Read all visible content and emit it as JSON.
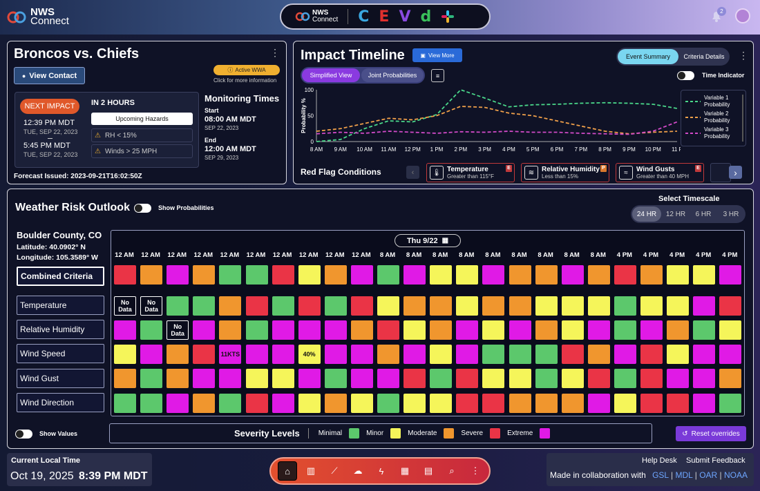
{
  "header": {
    "logo_line1": "NWS",
    "logo_line2": "Connect",
    "app_logo_line1": "NWS",
    "app_logo_line2": "Connect",
    "notification_count": "2"
  },
  "event": {
    "title": "Broncos vs. Chiefs",
    "view_contact": "View Contact",
    "active_wwa": "Active WWA",
    "active_wwa_hint": "Click for more information",
    "next_impact": "NEXT IMPACT",
    "in_time": "IN 2 HOURS",
    "start_time": "12:39 PM MDT",
    "start_date": "TUE, SEP 22, 2023",
    "end_time": "5:45 PM MDT",
    "end_date": "TUE, SEP 22, 2023",
    "upcoming_hazards": "Upcoming Hazards",
    "hazard1": "RH < 15%",
    "hazard2": "Winds > 25 MPH",
    "monitoring_title": "Monitoring Times",
    "start_label": "Start",
    "mon_start_time": "08:00 AM MDT",
    "mon_start_date": "SEP 22, 2023",
    "end_label": "End",
    "mon_end_time": "12:00 AM MDT",
    "mon_end_date": "SEP 29, 2023",
    "forecast_issued": "Forecast Issued: 2023-09-21T16:02:50Z"
  },
  "impact": {
    "title": "Impact Timeline",
    "view_more": "View More",
    "event_summary": "Event Summary",
    "criteria_details": "Criteria Details",
    "simplified_view": "Simplified View",
    "joint_probabilities": "Joint Probabilities",
    "time_indicator": "Time Indicator",
    "red_flag_title": "Red Flag Conditions",
    "red_flags": [
      {
        "label": "Temperature",
        "sub": "Greater than 115°F",
        "flag": "E",
        "flag_color": "#c0393b"
      },
      {
        "label": "Relative Humidity",
        "sub": "Less than 15%",
        "flag": "P",
        "flag_color": "#d9782d"
      },
      {
        "label": "Wind Gusts",
        "sub": "Greater than 40 MPH",
        "flag": "E",
        "flag_color": "#c0393b"
      }
    ]
  },
  "chart_data": {
    "type": "line",
    "ylabel": "Probability %",
    "ylim": [
      0,
      100
    ],
    "yticks": [
      "100",
      "50",
      "0"
    ],
    "categories": [
      "8 AM",
      "9 AM",
      "10 AM",
      "11 AM",
      "12 PM",
      "1 PM",
      "2 PM",
      "3 PM",
      "4 PM",
      "5 PM",
      "6 PM",
      "7 PM",
      "8 PM",
      "9 PM",
      "10 PM",
      "11 P"
    ],
    "series": [
      {
        "name": "Variable 1 Probability",
        "color": "#4ad88a",
        "values": [
          0,
          4,
          25,
          40,
          38,
          52,
          100,
          84,
          67,
          71,
          72,
          74,
          75,
          74,
          72,
          64
        ]
      },
      {
        "name": "Variable 2 Probability",
        "color": "#f0a04a",
        "values": [
          20,
          25,
          35,
          45,
          42,
          50,
          68,
          66,
          55,
          50,
          40,
          30,
          20,
          15,
          18,
          20
        ]
      },
      {
        "name": "Variable 3 Probability",
        "color": "#d24ac8",
        "values": [
          15,
          18,
          16,
          20,
          18,
          16,
          19,
          18,
          20,
          18,
          18,
          16,
          15,
          14,
          20,
          38
        ]
      }
    ]
  },
  "outlook": {
    "title": "Weather Risk Outlook",
    "show_probabilities": "Show Probabilities",
    "select_timescale": "Select Timescale",
    "timescales": [
      "24 HR",
      "12 HR",
      "6 HR",
      "3 HR"
    ],
    "location": "Boulder County, CO",
    "latitude": "Latitude: 40.0902° N",
    "longitude": "Longitude: 105.3589° W",
    "date": "Thu 9/22",
    "time_ticks": [
      "12 AM",
      "12 AM",
      "12 AM",
      "12 AM",
      "12 AM",
      "12 AM",
      "12 AM",
      "12 AM",
      "12 AM",
      "12 AM",
      "8 AM",
      "8 AM",
      "8 AM",
      "8 AM",
      "8 AM",
      "8 AM",
      "8 AM",
      "8 AM",
      "8 AM",
      "4 PM",
      "4 PM",
      "4 PM",
      "4 PM",
      "4 PM"
    ],
    "rows": [
      {
        "label": "Combined Criteria",
        "cells": [
          "R",
          "O",
          "M",
          "O",
          "G",
          "G",
          "R",
          "Y",
          "O",
          "M",
          "G",
          "M",
          "Y",
          "Y",
          "M",
          "O",
          "O",
          "M",
          "O",
          "R",
          "O",
          "Y",
          "Y",
          "M"
        ]
      },
      {
        "label": "Temperature",
        "cells": [
          "N",
          "N",
          "G",
          "G",
          "O",
          "R",
          "G",
          "R",
          "G",
          "R",
          "Y",
          "O",
          "O",
          "Y",
          "O",
          "O",
          "Y",
          "Y",
          "Y",
          "G",
          "Y",
          "Y",
          "M",
          "R"
        ]
      },
      {
        "label": "Relative Humidity",
        "cells": [
          "M",
          "G",
          "N",
          "M",
          "O",
          "G",
          "M",
          "M",
          "M",
          "O",
          "R",
          "Y",
          "O",
          "M",
          "Y",
          "M",
          "O",
          "Y",
          "M",
          "G",
          "M",
          "O",
          "G",
          "Y"
        ]
      },
      {
        "label": "Wind Speed",
        "cells": [
          "Y",
          "M",
          "O",
          "R",
          "M:11KTS",
          "M",
          "M",
          "Y:40%",
          "M",
          "M",
          "O",
          "M",
          "Y",
          "M",
          "G",
          "G",
          "G",
          "R",
          "O",
          "M",
          "R",
          "Y",
          "M",
          "M"
        ]
      },
      {
        "label": "Wind Gust",
        "cells": [
          "O",
          "G",
          "O",
          "M",
          "M",
          "Y",
          "Y",
          "M",
          "G",
          "M",
          "M",
          "R",
          "G",
          "R",
          "Y",
          "Y",
          "G",
          "Y",
          "R",
          "G",
          "R",
          "M",
          "M",
          "O"
        ]
      },
      {
        "label": "Wind Direction",
        "cells": [
          "G",
          "G",
          "M",
          "O",
          "G",
          "R",
          "M",
          "Y",
          "O",
          "Y",
          "G",
          "Y",
          "Y",
          "R",
          "R",
          "O",
          "O",
          "O",
          "M",
          "Y",
          "R",
          "R",
          "M",
          "G"
        ]
      }
    ],
    "no_data": "No Data",
    "severity_title": "Severity Levels",
    "severity": [
      {
        "label": "Minimal",
        "color": "#5cc86c"
      },
      {
        "label": "Minor",
        "color": "#f5f55a"
      },
      {
        "label": "Moderate",
        "color": "#f0962e"
      },
      {
        "label": "Severe",
        "color": "#ea3446"
      },
      {
        "label": "Extreme",
        "color": "#e01ae6"
      }
    ],
    "show_values": "Show Values",
    "reset_overrides": "Reset overrides"
  },
  "footer": {
    "current_time_label": "Current Local Time",
    "date": "Oct 19, 2025",
    "time": "8:39 PM MDT",
    "help_desk": "Help Desk",
    "submit_feedback": "Submit Feedback",
    "collab": "Made in collaboration with",
    "partners": [
      "GSL",
      "MDL",
      "OAR",
      "NOAA"
    ]
  }
}
